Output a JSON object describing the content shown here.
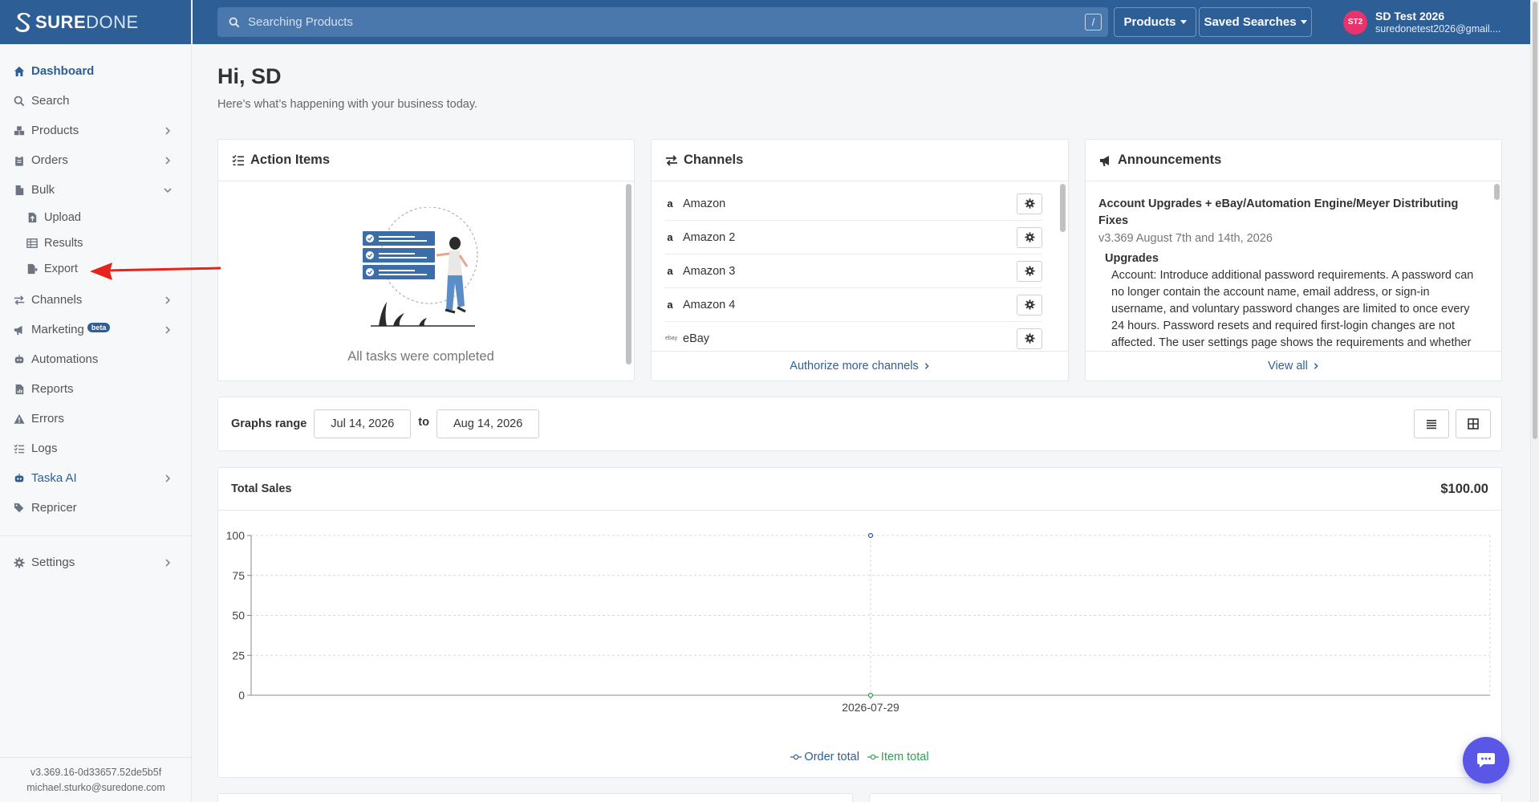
{
  "app": {
    "logo_text_bold": "SURE",
    "logo_text_light": "DONE"
  },
  "sidebar": {
    "items": [
      {
        "label": "Dashboard",
        "icon": "home-icon"
      },
      {
        "label": "Search",
        "icon": "search-icon"
      },
      {
        "label": "Products",
        "icon": "boxes-icon"
      },
      {
        "label": "Orders",
        "icon": "clipboard-icon"
      },
      {
        "label": "Bulk",
        "icon": "file-icon"
      },
      {
        "label": "Channels",
        "icon": "exchange-icon"
      },
      {
        "label": "Marketing",
        "icon": "megaphone-icon",
        "badge": "beta"
      },
      {
        "label": "Automations",
        "icon": "robot-icon"
      },
      {
        "label": "Reports",
        "icon": "report-icon"
      },
      {
        "label": "Errors",
        "icon": "warning-icon"
      },
      {
        "label": "Logs",
        "icon": "list-icon"
      },
      {
        "label": "Taska AI",
        "icon": "robot-icon"
      },
      {
        "label": "Repricer",
        "icon": "tags-icon"
      },
      {
        "label": "Settings",
        "icon": "gear-icon"
      }
    ],
    "bulk_sub": [
      {
        "label": "Upload",
        "icon": "file-upload-icon"
      },
      {
        "label": "Results",
        "icon": "table-icon"
      },
      {
        "label": "Export",
        "icon": "file-export-icon"
      }
    ],
    "footer_version": "v3.369.16-0d33657.52de5b5f",
    "footer_email": "michael.sturko@suredone.com"
  },
  "topbar": {
    "search_placeholder": "Searching Products",
    "search_shortcut": "/",
    "products_btn": "Products",
    "saved_searches_btn": "Saved Searches",
    "avatar_initials": "ST2",
    "user_name": "SD Test 2026",
    "user_email": "suredonetest2026@gmail...."
  },
  "main": {
    "greeting": "Hi, SD",
    "subgreeting": "Here’s what’s happening with your business today."
  },
  "action_items": {
    "title": "Action Items",
    "empty_text": "All tasks were completed"
  },
  "channels": {
    "title": "Channels",
    "rows": [
      {
        "name": "Amazon",
        "brand": "a"
      },
      {
        "name": "Amazon 2",
        "brand": "a"
      },
      {
        "name": "Amazon 3",
        "brand": "a"
      },
      {
        "name": "Amazon 4",
        "brand": "a"
      },
      {
        "name": "eBay",
        "brand": "ebay"
      }
    ],
    "footer_link": "Authorize more channels"
  },
  "announcements": {
    "title": "Announcements",
    "post_title": "Account Upgrades + eBay/Automation Engine/Meyer Distributing Fixes",
    "post_version": "v3.369 August 7th and 14th, 2026",
    "section": "Upgrades",
    "body": "Account: Introduce additional password requirements. A password can no longer contain the account name, email address, or sign-in username, and voluntary password changes are limited to once every 24 hours. Password resets and required first-login changes are not affected. The user settings page shows the requirements and whether",
    "footer_link": "View all"
  },
  "graphs_range": {
    "label": "Graphs range",
    "from": "Jul 14, 2026",
    "to_label": "to",
    "to": "Aug 14, 2026"
  },
  "total_sales": {
    "title": "Total Sales",
    "value": "$100.00"
  },
  "colors": {
    "brand": "#2e5e96",
    "order_total": "#2e5e96",
    "item_total": "#2e9e4f",
    "annotation_arrow": "#e8231c",
    "chat": "#5a57e6"
  },
  "chart_data": {
    "type": "line",
    "title": "",
    "xlabel": "",
    "ylabel": "",
    "categories": [
      "2026-07-29"
    ],
    "ylim": [
      0,
      100
    ],
    "yticks": [
      0,
      25,
      50,
      75,
      100
    ],
    "grid": true,
    "legend": "bottom",
    "series": [
      {
        "name": "Order total",
        "values": [
          100
        ],
        "color": "#2e5e96"
      },
      {
        "name": "Item total",
        "values": [
          0
        ],
        "color": "#2e9e4f"
      }
    ]
  }
}
